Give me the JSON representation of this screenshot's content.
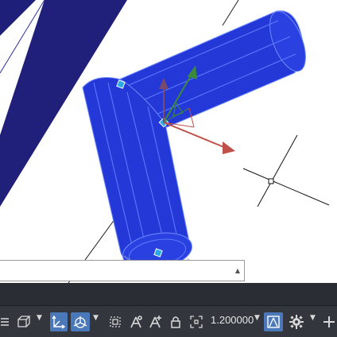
{
  "viewport": {
    "model": "bent-pipe-solid"
  },
  "command_line": {
    "value": "",
    "dropdown_glyph": "▲"
  },
  "status_bar": {
    "scale_value": "1.200000",
    "dropdown_glyph": "▼",
    "icons": [
      "list-icon",
      "isometric-drafting-icon",
      "dynamic-ucs-icon",
      "gizmo-icon",
      "selection-filter-icon",
      "annotation-visibility-icon",
      "auto-scale-icon",
      "lock-ui-icon",
      "isolate-objects-icon",
      "annotation-monitor-icon",
      "workspace-gear-icon",
      "customize-plus-icon"
    ]
  },
  "colors": {
    "solid": "#2438d8",
    "solid_dark": "#1a26a8",
    "solid_edge": "#6f8cff",
    "background_band": "#20207a",
    "statusbar": "#33363c",
    "active_button": "#4a78b8",
    "gizmo_x": "#c0504a",
    "gizmo_y": "#3a8a3a"
  }
}
